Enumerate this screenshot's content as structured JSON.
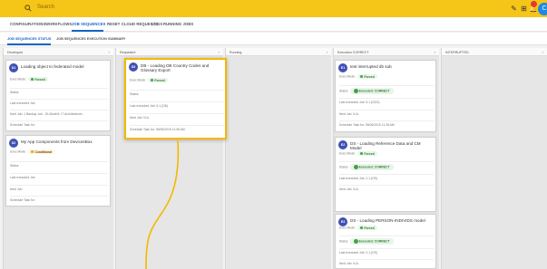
{
  "topbar": {
    "search_placeholder": "Search",
    "icons": [
      "search-icon",
      "edit-icon",
      "grid-icon",
      "bell-icon"
    ],
    "avatar_initial": "C"
  },
  "nav": {
    "items": [
      "CONFIGURATIONS",
      "WORKFLOWS",
      "JOB SEQUENCES",
      "RESET CLOUD REQUESTS",
      "LOGS",
      "RUNNING JOBS"
    ],
    "active": "JOB SEQUENCES"
  },
  "subnav": {
    "items": [
      "JOB SEQUENCES STATUS",
      "JOB SEQUENCES EXECUTION SUMMARY"
    ],
    "active": "JOB SEQUENCES STATUS"
  },
  "columns": [
    {
      "title": "Developed"
    },
    {
      "title": "Requested"
    },
    {
      "title": "Running"
    },
    {
      "title": "Execution CORRECT"
    },
    {
      "title": "INTERRUPTED"
    }
  ],
  "cards": {
    "c1": {
      "initials": "D1",
      "title": "Loading object to federated model",
      "exec_mode_label": "Exec Mode:",
      "mode": "Forced",
      "status": "Status",
      "last_exec_job": "Last executed Job",
      "next_job": "Next Job: 1 Backup Job - DI-Model1: IT Architectures",
      "schedule": "Schedule Task for:"
    },
    "c2": {
      "initials": "D2",
      "title": "My App Components from DevicesBox",
      "exec_mode_label": "Exec Mode:",
      "mode": "Conditional",
      "status": "Status",
      "last_exec_job": "Last executed Job",
      "next_job": "Next Job",
      "schedule": "Schedule Task for:"
    },
    "c3": {
      "initials": "D3",
      "title": "DB - Loading DB Country Codes and Glossary Export",
      "exec_mode_label": "Exec Mode:",
      "mode": "Forced",
      "status": "Status",
      "last_exec_job": "Last executed Job: 5.1.(DB)",
      "next_job": "Next Job: N.A.",
      "schedule": "Schedule Task for: 05/06/2019 11:36 AM"
    },
    "c4": {
      "initials": "E1",
      "title": "test interrupted db sub",
      "exec_mode_label": "Exec Mode:",
      "mode": "Forced",
      "status_label": "Status",
      "status": "Executed: CORRECT",
      "last_exec_job": "Last executed Job: 5.1.(DDS)",
      "next_job": "Next Job: N.A.",
      "schedule": "Schedule Task for: 05/06/2019 11:28 AM"
    },
    "c5": {
      "initials": "E2",
      "title": "DS - Loading Reference Data and CM Model",
      "exec_mode_label": "Exec Mode:",
      "mode": "Forced",
      "status_label": "Status",
      "status": "Executed: CORRECT",
      "last_exec_job": "Last executed Job: 2.1.(DS)",
      "next_job": "Next Job: N.A."
    },
    "c6": {
      "initials": "E3",
      "title": "DS - Loading PERSON-INDIVIDS model",
      "exec_mode_label": "Exec Mode:",
      "mode": "Forced",
      "status_label": "Status",
      "status": "Executed: CORRECT",
      "last_exec_job": "Last executed Job: 2.1.(DS)",
      "next_job": "Next Job: N.A."
    }
  },
  "colors": {
    "accent": "#f5c518",
    "primary": "#1565c0",
    "success": "#43a047",
    "avatar": "#3f51b5"
  }
}
